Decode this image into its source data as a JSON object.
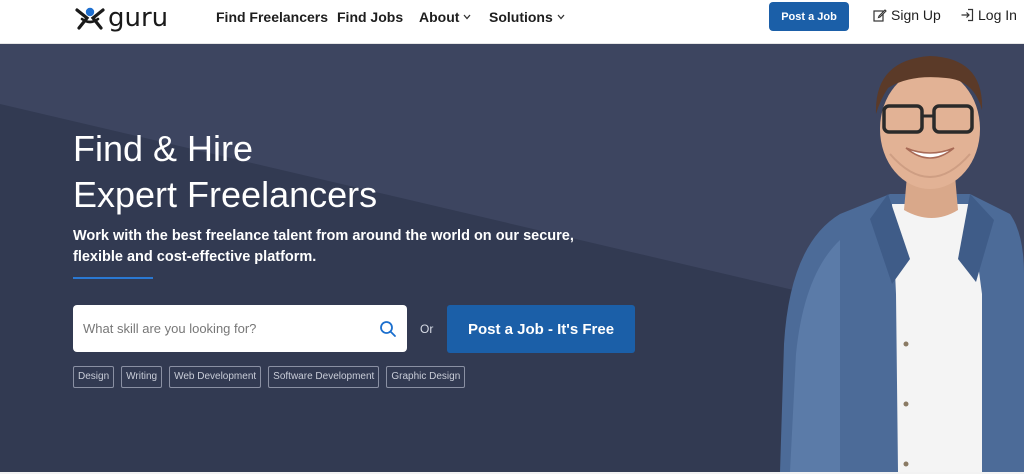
{
  "nav": {
    "logo_text": "guru",
    "links": [
      {
        "label": "Find Freelancers"
      },
      {
        "label": "Find Jobs"
      },
      {
        "label": "About"
      },
      {
        "label": "Solutions"
      }
    ],
    "caret": "⌄",
    "post_job": "Post a Job",
    "sign_up": "Sign Up",
    "log_in": "Log In"
  },
  "hero": {
    "title_line1": "Find & Hire",
    "title_line2": "Expert Freelancers",
    "subtitle_line1": "Work with the best freelance talent from around the world on our secure,",
    "subtitle_line2": "flexible and cost-effective platform.",
    "search_placeholder": "What skill are you looking for?",
    "or_text": "Or",
    "cta_label": "Post a Job - It's Free",
    "tags": [
      "Design",
      "Writing",
      "Web Development",
      "Software Development",
      "Graphic Design"
    ]
  },
  "colors": {
    "hero_bg": "#323a52",
    "hero_bg_light": "#3d4560",
    "accent": "#1b5fa8",
    "rule": "#2a78d2"
  },
  "icons": [
    "guru-logo-icon",
    "search-icon",
    "edit-icon",
    "login-icon",
    "chevron-down-icon"
  ]
}
